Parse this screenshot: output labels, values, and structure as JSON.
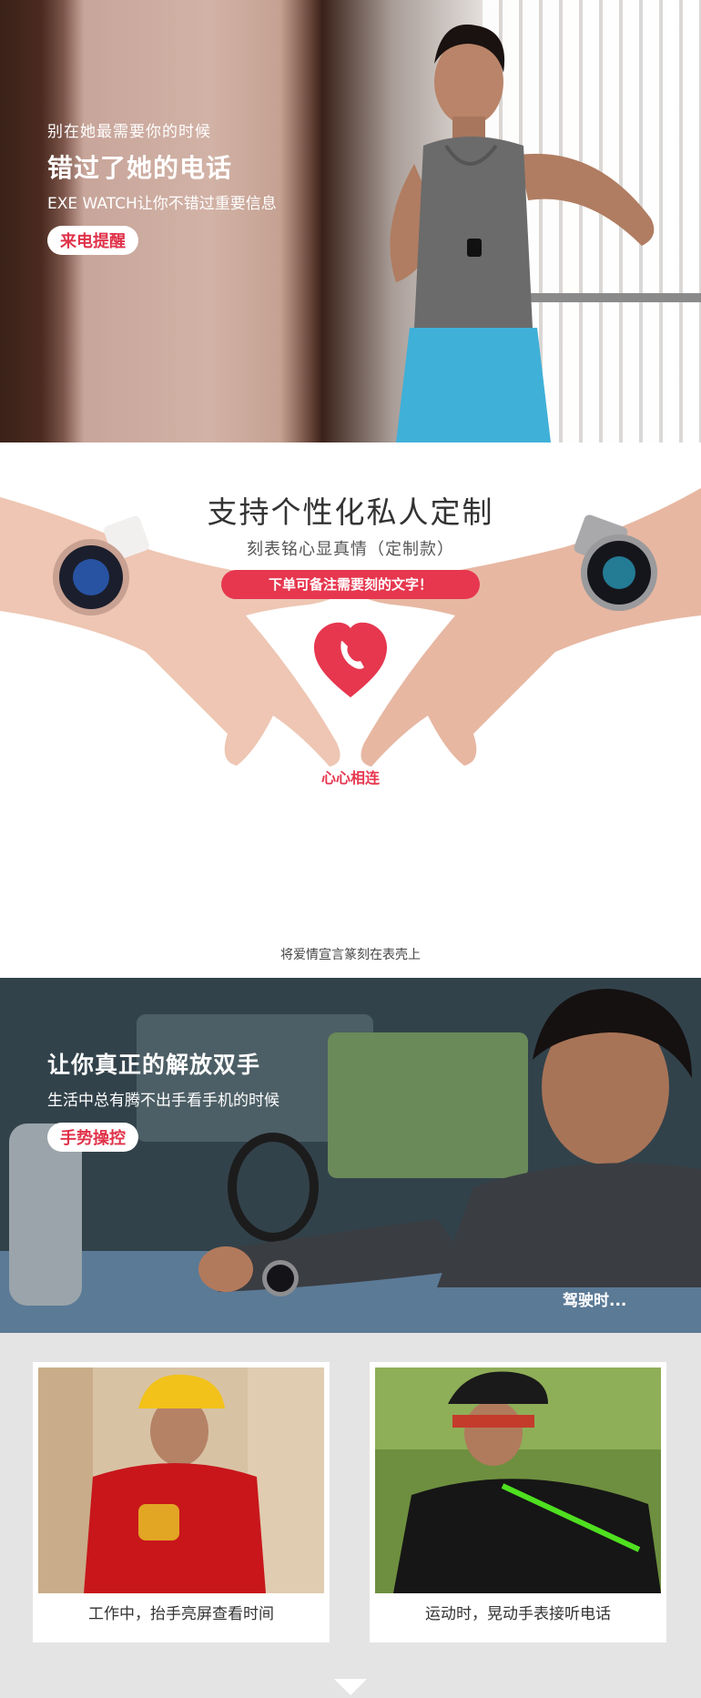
{
  "call_section": {
    "pre_text": "别在她最需要你的时候",
    "headline": "错过了她的电话",
    "subtext": "EXE WATCH让你不错过重要信息",
    "badge": "来电提醒"
  },
  "custom_section": {
    "title": "支持个性化私人定制",
    "subtitle": "刻表铭心显真情（定制款）",
    "note": "下单可备注需要刻的文字！",
    "heart_label": "心心相连",
    "caption": "将爱情宣言篆刻在表壳上"
  },
  "gesture_section": {
    "headline": "让你真正的解放双手",
    "subtext": "生活中总有腾不出手看手机的时候",
    "badge": "手势操控",
    "scene_label": "驾驶时..."
  },
  "cards": [
    {
      "caption": "工作中，抬手亮屏查看时间"
    },
    {
      "caption": "运动时，晃动手表接听电话"
    }
  ],
  "icons": {
    "heart": "heart-phone-icon",
    "down_arrow": "down-arrow-icon"
  },
  "colors": {
    "accent": "#e6374f",
    "badge_text": "#e0334a",
    "card_background": "#e4e4e4"
  }
}
